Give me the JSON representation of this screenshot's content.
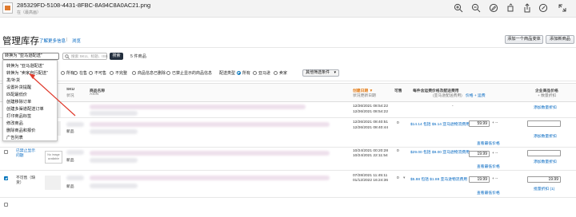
{
  "viewer": {
    "filename": "285329FD-5108-4431-8FBC-8A94C8A0AC21.png",
    "subtitle": "在（最高画）",
    "icons": [
      "zoom-in-icon",
      "zoom-out-icon",
      "markup-icon",
      "edit-icon",
      "rotate-icon",
      "share-icon",
      "expand-icon"
    ]
  },
  "header": {
    "title": "管理库存",
    "learn_more": "了解更多信息",
    "separator": "|",
    "view_link": "浏览",
    "add_variation_button": "添加一个商品变体",
    "add_product_button": "添加新商品"
  },
  "actions": {
    "selected_action": "转换为 \"亚马逊配送\"",
    "search_placeholder": "搜索 SKU、标题、ISB",
    "search_button": "搜索",
    "result_count": "5 件商品"
  },
  "menu": {
    "items": [
      "转换为 \"亚马逊配送\"",
      "转换为 \"卖家自行配送\"",
      "发/补货",
      "设置补货提醒",
      "匹配最低价",
      "创建移除订单",
      "创建多渠道配送订单",
      "打印商品标签",
      "修改商品",
      "删除商品和报价",
      "广告列表"
    ]
  },
  "filters": {
    "all": "所有",
    "active": "在售",
    "inactive": "不可售",
    "incomplete": "不完整",
    "suppressed": "商品信息已删除",
    "blocked": "已禁止显示的商品信息",
    "fulfillment_label": "配送类型",
    "fulfillment_all": "所有",
    "amazon": "亚马逊",
    "merchant": "卖家",
    "more_filters": "其他筛选条件"
  },
  "columns": {
    "status": "状态",
    "sku": "SKU",
    "sku_sub": "状况",
    "name": "商品名称",
    "name_sub": "ASIN",
    "date": "创建日期",
    "date_sub": "状况更新日期",
    "available": "可售",
    "price_header": "每件含运费价格及配送费用",
    "price_sub": "(亚马逊配送费用)",
    "price_col": "价格 + 运费",
    "enterprise_price": "企业商品价格",
    "enterprise_sub": "+ 数量折扣"
  },
  "rows": [
    {
      "checked": false,
      "status": "",
      "sku_note": "",
      "created": "12/26/2021 08:54:22",
      "updated": "12/26/2021 08:54:22",
      "available": "",
      "fee": "-",
      "price": "",
      "shipping": "",
      "more_link": "",
      "enterprise_link": "添加数量折扣",
      "enterprise_price": ""
    },
    {
      "checked": false,
      "status": "",
      "sku_note": "新品",
      "created": "12/26/2021 08:40:51",
      "updated": "12/26/2021 08:40:44",
      "available": "0",
      "fee": "$14.14 包括 $5.14 亚马逊物流费用",
      "price": "59.99",
      "shipping": "+ --",
      "more_link": "查看最低价格",
      "enterprise_link": "添加数量折扣",
      "enterprise_price": ""
    },
    {
      "checked": false,
      "status": "已禁止显示 问题",
      "sku_note": "新品",
      "created": "10/24/2021 00:20:28",
      "updated": "10/24/2021 22:11:54",
      "available": "0",
      "fee": "$29.00 包括 $9.00 亚马逊物流费用",
      "price": "19.99",
      "shipping": "+ --",
      "more_link": "查看最低价格",
      "enterprise_link": "添加数量折扣",
      "enterprise_price": "",
      "noimage": "No image available"
    },
    {
      "checked": true,
      "status": "不可售（缺货）",
      "sku_note": "新品",
      "created": "07/28/2021 11:45:11",
      "updated": "01/12/2022 16:24:36",
      "available": "0",
      "fee": "$5.88 包括 $1.88 亚马逊物流费用",
      "price": "19.99",
      "shipping": "+ --",
      "more_link": "查看最低价格",
      "enterprise_link": "批量折扣 (1)",
      "enterprise_price": "19.99"
    }
  ],
  "colors": {
    "link": "#0066c0",
    "sorted": "#e47911",
    "search_button": "#232f3e",
    "arrow": "#e0392b"
  }
}
